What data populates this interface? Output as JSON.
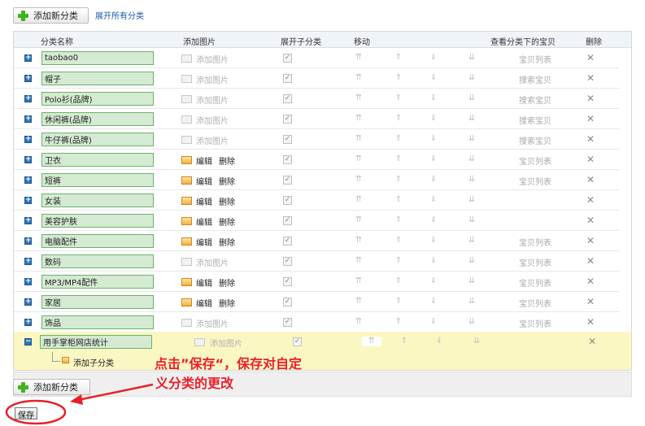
{
  "toolbar": {
    "add_category_label": "添加新分类",
    "expand_all_label": "展开所有分类"
  },
  "table": {
    "headers": {
      "name": "分类名称",
      "add_picture": "添加图片",
      "expand_sub": "展开子分类",
      "move": "移动",
      "view_items": "查看分类下的宝贝",
      "delete": "删除"
    },
    "rows": [
      {
        "name": "taobao0",
        "picture": "添加图片",
        "items_link": "宝贝列表"
      },
      {
        "name": "帽子",
        "picture": "添加图片",
        "items_link": "搜索宝贝"
      },
      {
        "name": "Polo衫(品牌)",
        "picture": "添加图片",
        "items_link": "搜索宝贝"
      },
      {
        "name": "休闲裤(品牌)",
        "picture": "添加图片",
        "items_link": "搜索宝贝"
      },
      {
        "name": "牛仔裤(品牌)",
        "picture": "添加图片",
        "items_link": "搜索宝贝"
      },
      {
        "name": "卫衣",
        "edit": "编辑",
        "delete": "删除",
        "items_link": "宝贝列表"
      },
      {
        "name": "短裤",
        "edit": "编辑",
        "delete": "删除",
        "items_link": "宝贝列表"
      },
      {
        "name": "女装",
        "edit": "编辑",
        "delete": "删除",
        "items_link": ""
      },
      {
        "name": "美容护肤",
        "edit": "编辑",
        "delete": "删除",
        "items_link": ""
      },
      {
        "name": "电脑配件",
        "edit": "编辑",
        "delete": "删除",
        "items_link": "宝贝列表"
      },
      {
        "name": "数码",
        "picture": "添加图片",
        "items_link": "宝贝列表"
      },
      {
        "name": "MP3/MP4配件",
        "edit": "编辑",
        "delete": "删除",
        "items_link": "宝贝列表"
      },
      {
        "name": "家居",
        "edit": "编辑",
        "delete": "删除",
        "items_link": "宝贝列表"
      },
      {
        "name": "饰品",
        "picture": "添加图片",
        "items_link": "宝贝列表"
      }
    ],
    "highlight_row": {
      "name": "用手掌柜网店统计",
      "picture": "添加图片"
    },
    "add_child_label": "添加子分类"
  },
  "icons": {
    "expand": "+",
    "collapse": "−",
    "checked": "✓",
    "move_top": "⇈",
    "move_up": "⇑",
    "move_down": "⇓",
    "move_bottom": "⇊",
    "delete": "✕",
    "scroll_up": "▲",
    "scroll_down": "▼"
  },
  "bottom": {
    "add_category_label": "添加新分类"
  },
  "annotation": {
    "line1": "点击”保存“，保存对自定",
    "line2": "义分类的更改",
    "color": "#e8202a"
  },
  "save_label": "保存"
}
